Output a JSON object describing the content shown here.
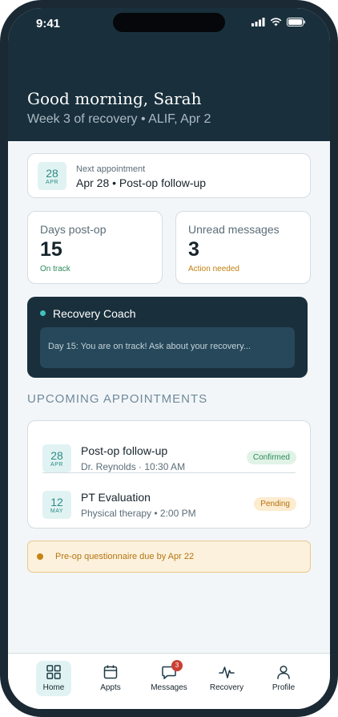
{
  "status_bar": {
    "time": "9:41"
  },
  "header": {
    "greeting": "Good morning, Sarah",
    "subtitle": "Week 3 of recovery • ALIF, Apr 2"
  },
  "next_appointment": {
    "day": "28",
    "month": "APR",
    "label": "Next appointment",
    "title": "Apr 28 • Post-op follow-up"
  },
  "stats": [
    {
      "label": "Days post-op",
      "value": "15",
      "note": "On track",
      "note_color": "#2d8b5a"
    },
    {
      "label": "Unread messages",
      "value": "3",
      "note": "Action needed",
      "note_color": "#c0800e"
    }
  ],
  "coach": {
    "name": "Recovery Coach",
    "message": "Day 15: You are on track! Ask about your recovery..."
  },
  "upcoming": {
    "section_title": "UPCOMING APPOINTMENTS",
    "items": [
      {
        "day": "28",
        "month": "APR",
        "title": "Post-op follow-up",
        "subtitle": "Dr. Reynolds · 10:30 AM",
        "status": "Confirmed",
        "status_bg": "#e1f3e7",
        "status_color": "#2d8b5a"
      },
      {
        "day": "12",
        "month": "MAY",
        "title": "PT Evaluation",
        "subtitle": "Physical therapy • 2:00 PM",
        "status": "Pending",
        "status_bg": "#fcecd0",
        "status_color": "#b5720f"
      }
    ]
  },
  "notice": {
    "text": "Pre-op questionnaire due by Apr 22"
  },
  "tab_bar": {
    "tabs": [
      {
        "label": "Home",
        "icon": "grid-icon",
        "active": true
      },
      {
        "label": "Appts",
        "icon": "calendar-icon"
      },
      {
        "label": "Messages",
        "icon": "chat-icon",
        "badge": "3"
      },
      {
        "label": "Recovery",
        "icon": "pulse-icon"
      },
      {
        "label": "Profile",
        "icon": "person-icon"
      }
    ]
  },
  "colors": {
    "primary_dark": "#19303c",
    "accent_teal": "#2d8b87",
    "background": "#f3f6f8"
  }
}
